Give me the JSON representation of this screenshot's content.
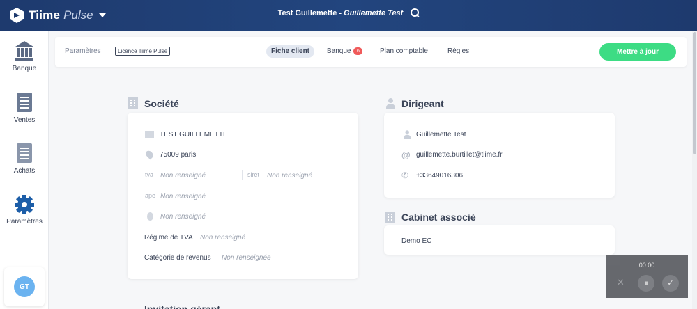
{
  "topbar": {
    "brand": "Tiime",
    "product": "Pulse",
    "client_name": "Test Guillemette",
    "separator": " - ",
    "user_name": "Guillemette Test"
  },
  "sidebar": {
    "items": [
      {
        "label": "Banque",
        "icon": "bank-icon"
      },
      {
        "label": "Ventes",
        "icon": "sales-icon"
      },
      {
        "label": "Achats",
        "icon": "purchases-icon"
      },
      {
        "label": "Paramètres",
        "icon": "gear-icon"
      }
    ],
    "avatar_initials": "GT"
  },
  "tabbar": {
    "breadcrumb": "Paramètres",
    "licence": "Licence Tiime Pulse",
    "tabs": [
      {
        "label": "Fiche client",
        "active": true
      },
      {
        "label": "Banque",
        "badge": "6"
      },
      {
        "label": "Plan comptable"
      },
      {
        "label": "Règles"
      }
    ],
    "update_button": "Mettre à jour"
  },
  "societe": {
    "title": "Société",
    "company_name": "TEST GUILLEMETTE",
    "address": "75009 paris",
    "tva_label": "tva",
    "tva_value": "Non renseigné",
    "siret_label": "siret",
    "siret_value": "Non renseigné",
    "ape_label": "ape",
    "ape_value": "Non renseigné",
    "medal_value": "Non renseigné",
    "regime_label": "Régime de TVA",
    "regime_value": "Non renseigné",
    "categorie_label": "Catégorie de revenus",
    "categorie_value": "Non renseignée"
  },
  "dirigeant": {
    "title": "Dirigeant",
    "name": "Guillemette Test",
    "email": "guillemette.burtillet@tiime.fr",
    "phone": "+33649016306"
  },
  "cabinet": {
    "title": "Cabinet associé",
    "name": "Demo EC"
  },
  "next_section": {
    "title": "Invitation gérant"
  },
  "recorder": {
    "time": "00:00",
    "close": "✕",
    "pause": "⏸",
    "confirm": "✓"
  },
  "colors": {
    "topbar": "#1e3a6e",
    "accent_green": "#3ddc84",
    "badge_red": "#f05a5a",
    "active_icon": "#1d5ea8"
  }
}
